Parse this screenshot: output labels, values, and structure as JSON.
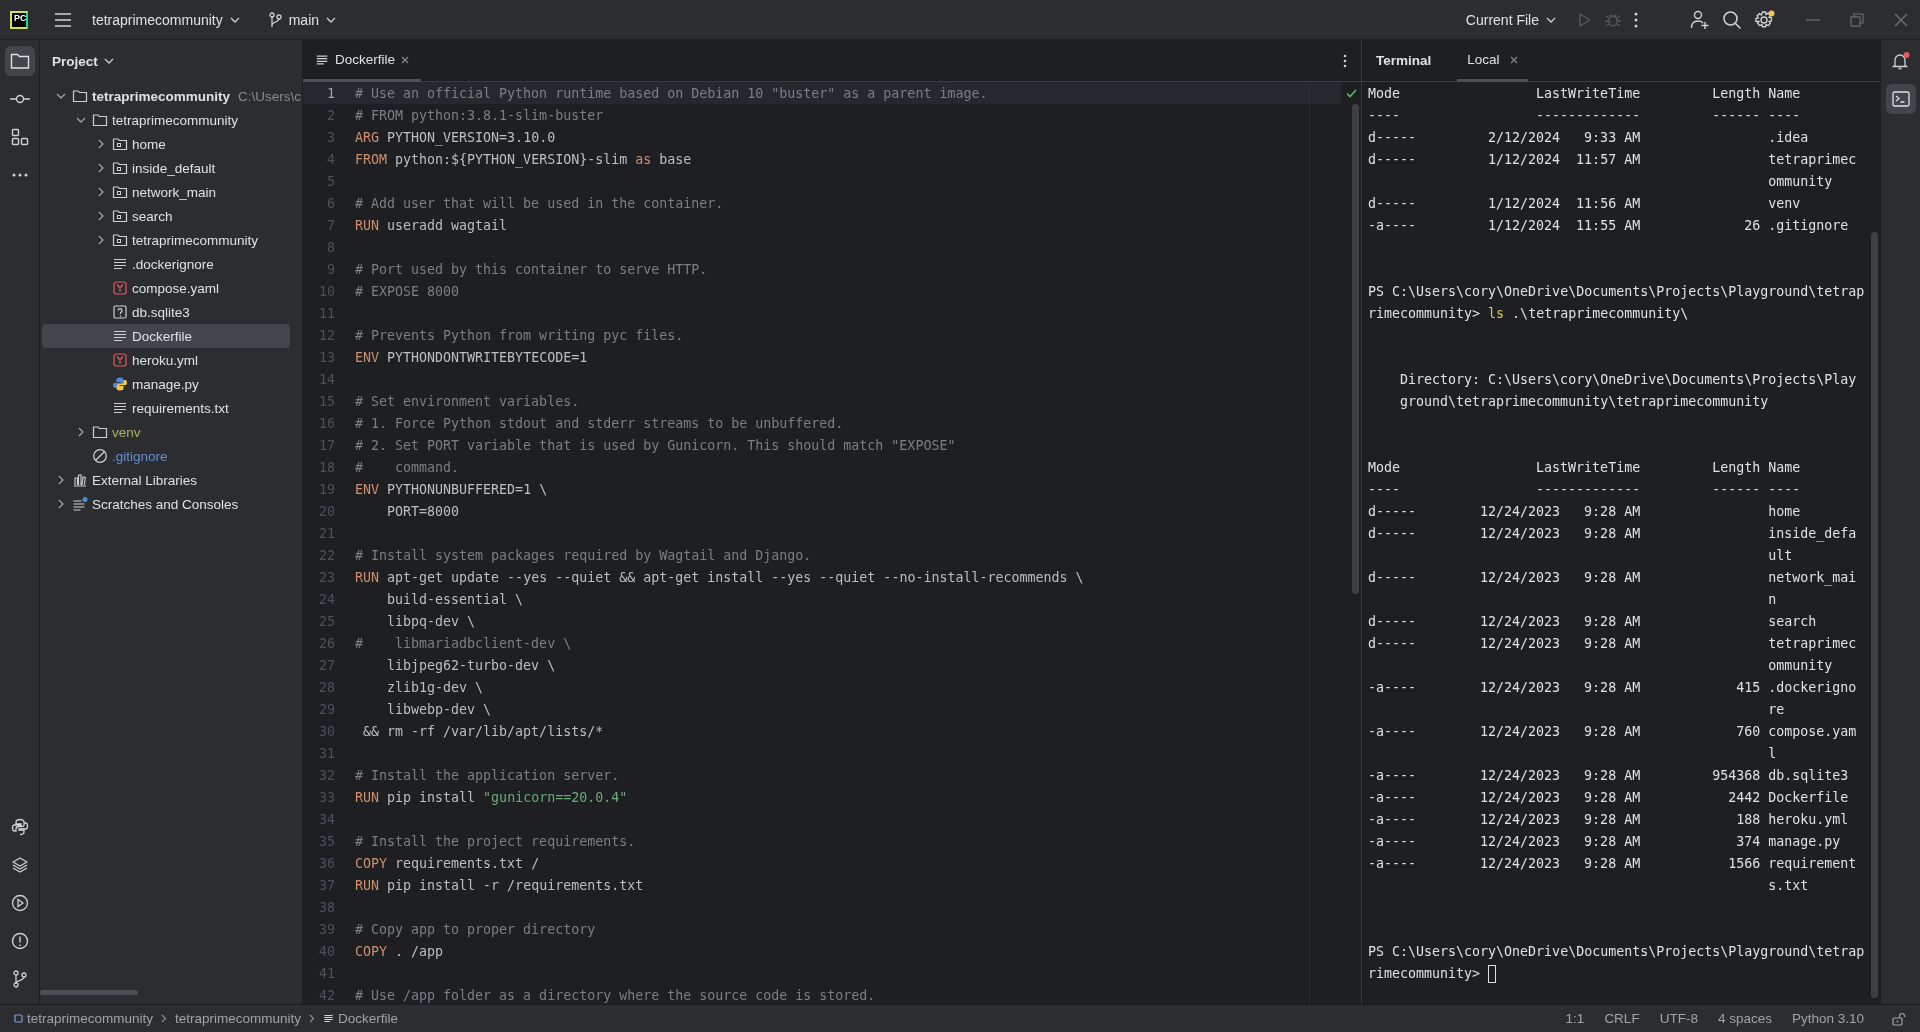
{
  "top_bar": {
    "logo": "PC",
    "project": "tetraprimecommunity",
    "branch": "main",
    "run_config": "Current File",
    "actions": [
      {
        "kind": "run",
        "disabled": true
      },
      {
        "kind": "debug",
        "disabled": true
      }
    ],
    "settings_badge": true
  },
  "left_strip": {
    "top": [
      {
        "kind": "project",
        "selected": true
      },
      {
        "kind": "commit",
        "selected": false
      },
      {
        "kind": "structure",
        "selected": false
      },
      {
        "kind": "more",
        "selected": false
      }
    ],
    "bottom": [
      {
        "kind": "python",
        "selected": false
      },
      {
        "kind": "layers",
        "selected": false
      },
      {
        "kind": "services",
        "selected": false
      },
      {
        "kind": "problems",
        "selected": false
      },
      {
        "kind": "git",
        "selected": false
      }
    ]
  },
  "project_panel": {
    "title": "Project",
    "tree": [
      {
        "label": "tetraprimecommunity",
        "kind": "root",
        "hint": "C:\\Users\\c",
        "expanded": true,
        "selected": false,
        "children": [
          {
            "label": "tetraprimecommunity",
            "kind": "folder",
            "expanded": true,
            "selected": false,
            "children": [
              {
                "label": "home",
                "kind": "module",
                "expanded": false,
                "selected": false
              },
              {
                "label": "inside_default",
                "kind": "module",
                "expanded": false,
                "selected": false
              },
              {
                "label": "network_main",
                "kind": "module",
                "expanded": false,
                "selected": false
              },
              {
                "label": "search",
                "kind": "module",
                "expanded": false,
                "selected": false
              },
              {
                "label": "tetraprimecommunity",
                "kind": "module",
                "expanded": false,
                "selected": false
              },
              {
                "label": ".dockerignore",
                "kind": "text",
                "selected": false
              },
              {
                "label": "compose.yaml",
                "kind": "yaml",
                "selected": false
              },
              {
                "label": "db.sqlite3",
                "kind": "unknown",
                "selected": false
              },
              {
                "label": "Dockerfile",
                "kind": "text",
                "selected": true
              },
              {
                "label": "heroku.yml",
                "kind": "yaml",
                "selected": false
              },
              {
                "label": "manage.py",
                "kind": "python",
                "selected": false
              },
              {
                "label": "requirements.txt",
                "kind": "text",
                "selected": false
              }
            ]
          },
          {
            "label": "venv",
            "kind": "folder",
            "expanded": false,
            "selected": false,
            "color": "#b3ae60"
          },
          {
            "label": ".gitignore",
            "kind": "ignore",
            "selected": false,
            "color": "#5f8fd0"
          }
        ]
      },
      {
        "label": "External Libraries",
        "kind": "library",
        "expanded": false,
        "selected": false
      },
      {
        "label": "Scratches and Consoles",
        "kind": "scratches",
        "expanded": false,
        "selected": false
      }
    ]
  },
  "editor": {
    "tabs": [
      {
        "label": "Dockerfile",
        "selected": true
      }
    ],
    "lines": [
      {
        "number": "1",
        "current": true,
        "tokens": [
          {
            "kind": "comment",
            "text": "# Use an official Python runtime based on Debian 10 \"buster\" as a parent image."
          }
        ]
      },
      {
        "number": "2",
        "current": false,
        "tokens": [
          {
            "kind": "comment",
            "text": "# FROM python:3.8.1-slim-buster"
          }
        ]
      },
      {
        "number": "3",
        "current": false,
        "tokens": [
          {
            "kind": "keyword",
            "text": "ARG"
          },
          {
            "kind": "plain",
            "text": " PYTHON_VERSION=3.10.0"
          }
        ]
      },
      {
        "number": "4",
        "current": false,
        "tokens": [
          {
            "kind": "keyword",
            "text": "FROM"
          },
          {
            "kind": "plain",
            "text": " python:${PYTHON_VERSION}-slim "
          },
          {
            "kind": "keyword",
            "text": "as"
          },
          {
            "kind": "plain",
            "text": " base"
          }
        ]
      },
      {
        "number": "5",
        "current": false
      },
      {
        "number": "6",
        "current": false,
        "tokens": [
          {
            "kind": "comment",
            "text": "# Add user that will be used in the container."
          }
        ]
      },
      {
        "number": "7",
        "current": false,
        "tokens": [
          {
            "kind": "keyword",
            "text": "RUN"
          },
          {
            "kind": "plain",
            "text": " useradd wagtail"
          }
        ]
      },
      {
        "number": "8",
        "current": false
      },
      {
        "number": "9",
        "current": false,
        "tokens": [
          {
            "kind": "comment",
            "text": "# Port used by this container to serve HTTP."
          }
        ]
      },
      {
        "number": "10",
        "current": false,
        "tokens": [
          {
            "kind": "comment",
            "text": "# EXPOSE 8000"
          }
        ]
      },
      {
        "number": "11",
        "current": false
      },
      {
        "number": "12",
        "current": false,
        "tokens": [
          {
            "kind": "comment",
            "text": "# Prevents Python from writing pyc files."
          }
        ]
      },
      {
        "number": "13",
        "current": false,
        "tokens": [
          {
            "kind": "keyword",
            "text": "ENV"
          },
          {
            "kind": "plain",
            "text": " PYTHONDONTWRITEBYTECODE=1"
          }
        ]
      },
      {
        "number": "14",
        "current": false
      },
      {
        "number": "15",
        "current": false,
        "tokens": [
          {
            "kind": "comment",
            "text": "# Set environment variables."
          }
        ]
      },
      {
        "number": "16",
        "current": false,
        "tokens": [
          {
            "kind": "comment",
            "text": "# 1. Force Python stdout and stderr streams to be unbuffered."
          }
        ]
      },
      {
        "number": "17",
        "current": false,
        "tokens": [
          {
            "kind": "comment",
            "text": "# 2. Set PORT variable that is used by Gunicorn. This should match \"EXPOSE\""
          }
        ]
      },
      {
        "number": "18",
        "current": false,
        "tokens": [
          {
            "kind": "comment",
            "text": "#    command."
          }
        ]
      },
      {
        "number": "19",
        "current": false,
        "tokens": [
          {
            "kind": "keyword",
            "text": "ENV"
          },
          {
            "kind": "plain",
            "text": " PYTHONUNBUFFERED=1 \\"
          }
        ]
      },
      {
        "number": "20",
        "current": false,
        "tokens": [
          {
            "kind": "plain",
            "text": "    PORT=8000"
          }
        ]
      },
      {
        "number": "21",
        "current": false
      },
      {
        "number": "22",
        "current": false,
        "tokens": [
          {
            "kind": "comment",
            "text": "# Install system packages required by Wagtail and Django."
          }
        ]
      },
      {
        "number": "23",
        "current": false,
        "tokens": [
          {
            "kind": "keyword",
            "text": "RUN"
          },
          {
            "kind": "plain",
            "text": " apt-get update --yes --quiet && apt-get install --yes --quiet --no-install-recommends \\"
          }
        ]
      },
      {
        "number": "24",
        "current": false,
        "tokens": [
          {
            "kind": "plain",
            "text": "    build-essential \\"
          }
        ]
      },
      {
        "number": "25",
        "current": false,
        "tokens": [
          {
            "kind": "plain",
            "text": "    libpq-dev \\"
          }
        ]
      },
      {
        "number": "26",
        "current": false,
        "tokens": [
          {
            "kind": "comment",
            "text": "#    libmariadbclient-dev \\"
          }
        ]
      },
      {
        "number": "27",
        "current": false,
        "tokens": [
          {
            "kind": "plain",
            "text": "    libjpeg62-turbo-dev \\"
          }
        ]
      },
      {
        "number": "28",
        "current": false,
        "tokens": [
          {
            "kind": "plain",
            "text": "    zlib1g-dev \\"
          }
        ]
      },
      {
        "number": "29",
        "current": false,
        "tokens": [
          {
            "kind": "plain",
            "text": "    libwebp-dev \\"
          }
        ]
      },
      {
        "number": "30",
        "current": false,
        "tokens": [
          {
            "kind": "plain",
            "text": " && rm -rf /var/lib/apt/lists/*"
          }
        ]
      },
      {
        "number": "31",
        "current": false
      },
      {
        "number": "32",
        "current": false,
        "tokens": [
          {
            "kind": "comment",
            "text": "# Install the application server."
          }
        ]
      },
      {
        "number": "33",
        "current": false,
        "tokens": [
          {
            "kind": "keyword",
            "text": "RUN"
          },
          {
            "kind": "plain",
            "text": " pip install "
          },
          {
            "kind": "string",
            "text": "\"gunicorn==20.0.4\""
          }
        ]
      },
      {
        "number": "34",
        "current": false
      },
      {
        "number": "35",
        "current": false,
        "tokens": [
          {
            "kind": "comment",
            "text": "# Install the project requirements."
          }
        ]
      },
      {
        "number": "36",
        "current": false,
        "tokens": [
          {
            "kind": "keyword",
            "text": "COPY"
          },
          {
            "kind": "plain",
            "text": " requirements.txt /"
          }
        ]
      },
      {
        "number": "37",
        "current": false,
        "tokens": [
          {
            "kind": "keyword",
            "text": "RUN"
          },
          {
            "kind": "plain",
            "text": " pip install -r /requirements.txt"
          }
        ]
      },
      {
        "number": "38",
        "current": false
      },
      {
        "number": "39",
        "current": false,
        "tokens": [
          {
            "kind": "comment",
            "text": "# Copy app to proper directory"
          }
        ]
      },
      {
        "number": "40",
        "current": false,
        "tokens": [
          {
            "kind": "keyword",
            "text": "COPY"
          },
          {
            "kind": "plain",
            "text": " . /app"
          }
        ]
      },
      {
        "number": "41",
        "current": false
      },
      {
        "number": "42",
        "current": false,
        "tokens": [
          {
            "kind": "comment",
            "text": "# Use /app folder as a directory where the source code is stored."
          }
        ]
      }
    ]
  },
  "terminal": {
    "title": "Terminal",
    "tabs": [
      {
        "label": "Local",
        "selected": true
      }
    ],
    "lines": [
      {
        "kind": "header",
        "mode": "Mode",
        "time": "LastWriteTime",
        "length": "Length",
        "name": "Name"
      },
      {
        "kind": "header",
        "mode": "----",
        "time": "-------------",
        "length": "------",
        "name": "----"
      },
      {
        "kind": "row",
        "mode": "d-----",
        "date": "2/12/2024",
        "time": "9:33 AM",
        "name": ".idea"
      },
      {
        "kind": "row",
        "mode": "d-----",
        "date": "1/12/2024",
        "time": "11:57 AM",
        "name": "tetraprimecommunity"
      },
      {
        "kind": "row",
        "mode": "d-----",
        "date": "1/12/2024",
        "time": "11:56 AM",
        "name": "venv"
      },
      {
        "kind": "row",
        "mode": "-a----",
        "date": "1/12/2024",
        "time": "11:55 AM",
        "length": "26",
        "name": ".gitignore"
      },
      {
        "kind": "blank"
      },
      {
        "kind": "blank"
      },
      {
        "kind": "input",
        "prompt": "PS C:\\Users\\cory\\OneDrive\\Documents\\Projects\\Playground\\tetraprimecommunity> ",
        "command": "ls",
        "args": " .\\tetraprimecommunity\\",
        "cursor": false
      },
      {
        "kind": "blank"
      },
      {
        "kind": "blank"
      },
      {
        "kind": "directory",
        "text": "Directory: C:\\Users\\cory\\OneDrive\\Documents\\Projects\\Playground\\tetraprimecommunity\\tetraprimecommunity"
      },
      {
        "kind": "blank"
      },
      {
        "kind": "blank"
      },
      {
        "kind": "header",
        "mode": "Mode",
        "time": "LastWriteTime",
        "length": "Length",
        "name": "Name"
      },
      {
        "kind": "header",
        "mode": "----",
        "time": "-------------",
        "length": "------",
        "name": "----"
      },
      {
        "kind": "row",
        "mode": "d-----",
        "date": "12/24/2023",
        "time": "9:28 AM",
        "name": "home"
      },
      {
        "kind": "row",
        "mode": "d-----",
        "date": "12/24/2023",
        "time": "9:28 AM",
        "name": "inside_default"
      },
      {
        "kind": "row",
        "mode": "d-----",
        "date": "12/24/2023",
        "time": "9:28 AM",
        "name": "network_main"
      },
      {
        "kind": "row",
        "mode": "d-----",
        "date": "12/24/2023",
        "time": "9:28 AM",
        "name": "search"
      },
      {
        "kind": "row",
        "mode": "d-----",
        "date": "12/24/2023",
        "time": "9:28 AM",
        "name": "tetraprimecommunity"
      },
      {
        "kind": "row",
        "mode": "-a----",
        "date": "12/24/2023",
        "time": "9:28 AM",
        "length": "415",
        "name": ".dockerignore"
      },
      {
        "kind": "row",
        "mode": "-a----",
        "date": "12/24/2023",
        "time": "9:28 AM",
        "length": "760",
        "name": "compose.yaml"
      },
      {
        "kind": "row",
        "mode": "-a----",
        "date": "12/24/2023",
        "time": "9:28 AM",
        "length": "954368",
        "name": "db.sqlite3"
      },
      {
        "kind": "row",
        "mode": "-a----",
        "date": "12/24/2023",
        "time": "9:28 AM",
        "length": "2442",
        "name": "Dockerfile"
      },
      {
        "kind": "row",
        "mode": "-a----",
        "date": "12/24/2023",
        "time": "9:28 AM",
        "length": "188",
        "name": "heroku.yml"
      },
      {
        "kind": "row",
        "mode": "-a----",
        "date": "12/24/2023",
        "time": "9:28 AM",
        "length": "374",
        "name": "manage.py"
      },
      {
        "kind": "row",
        "mode": "-a----",
        "date": "12/24/2023",
        "time": "9:28 AM",
        "length": "1566",
        "name": "requirements.txt"
      },
      {
        "kind": "blank"
      },
      {
        "kind": "blank"
      },
      {
        "kind": "input",
        "prompt": "PS C:\\Users\\cory\\OneDrive\\Documents\\Projects\\Playground\\tetraprimecommunity> ",
        "cursor": true
      }
    ]
  },
  "right_strip": [
    {
      "kind": "notifications",
      "badge": true,
      "selected": false
    },
    {
      "kind": "terminal",
      "selected": true
    }
  ],
  "status_bar": {
    "breadcrumbs": [
      {
        "kind": "module",
        "label": "tetraprimecommunity"
      },
      {
        "kind": "folder",
        "label": "tetraprimecommunity"
      },
      {
        "kind": "file",
        "label": "Dockerfile"
      }
    ],
    "widgets": [
      "1:1",
      "CRLF",
      "UTF-8",
      "4 spaces",
      "Python 3.10"
    ]
  }
}
